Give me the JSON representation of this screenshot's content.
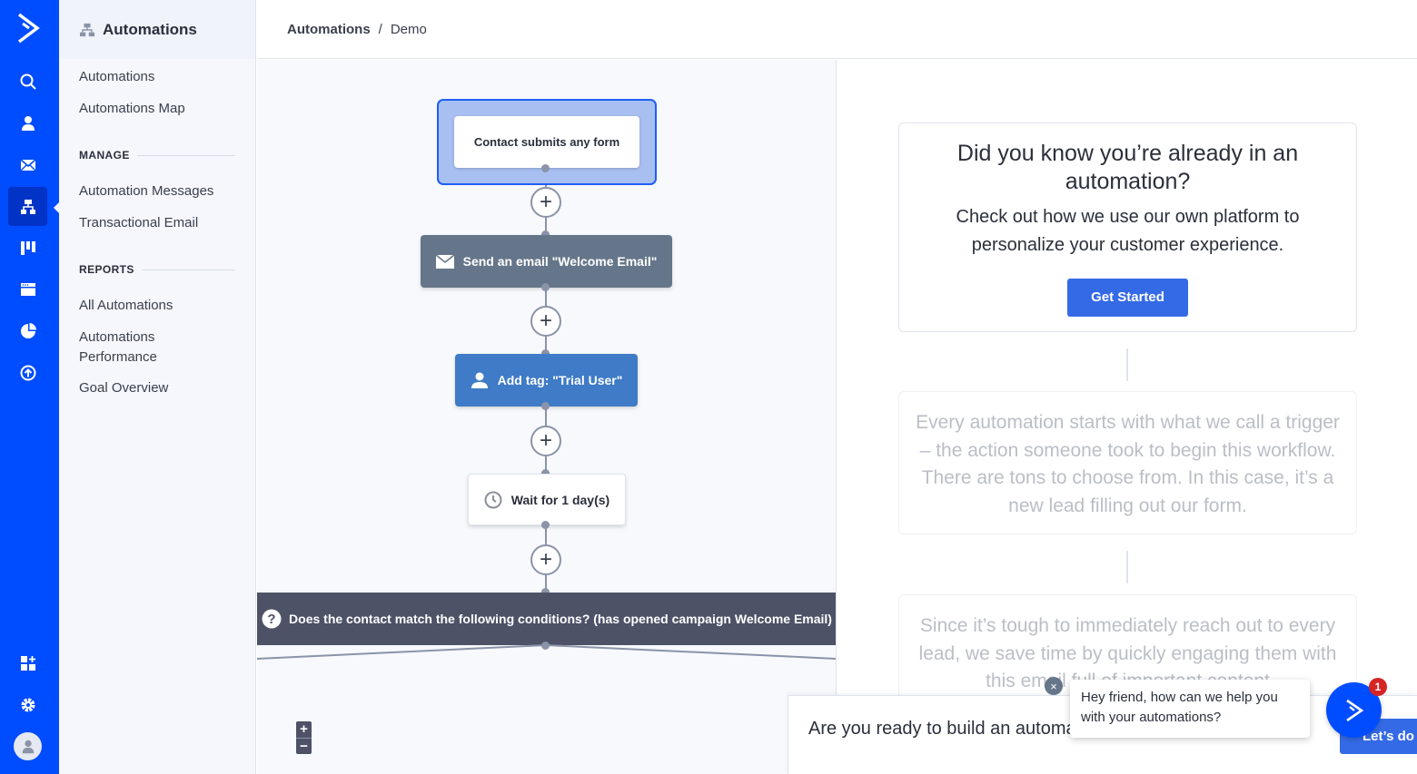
{
  "colors": {
    "brand": "#004cff",
    "brand_active": "#0033c6",
    "primary_button": "#356ae6",
    "email_node": "#66768a",
    "tag_node": "#3f7bc6",
    "condition_node": "#4d5267",
    "trigger_highlight": "#a8bff2",
    "badge": "#d62424"
  },
  "rail": {
    "logo": "activecampaign-logo",
    "items": [
      {
        "icon": "search-icon",
        "label": "Search"
      },
      {
        "icon": "contacts-icon",
        "label": "Contacts"
      },
      {
        "icon": "campaigns-icon",
        "label": "Campaigns"
      },
      {
        "icon": "automations-icon",
        "label": "Automations",
        "active": true
      },
      {
        "icon": "deals-icon",
        "label": "Deals"
      },
      {
        "icon": "website-icon",
        "label": "Website"
      },
      {
        "icon": "reports-icon",
        "label": "Reports"
      },
      {
        "icon": "upgrade-icon",
        "label": "Upgrade"
      }
    ],
    "bottom": [
      {
        "icon": "apps-icon",
        "label": "Apps"
      },
      {
        "icon": "settings-icon",
        "label": "Settings"
      },
      {
        "icon": "avatar-icon",
        "label": "Account"
      }
    ]
  },
  "subnav": {
    "title": "Automations",
    "links": [
      "Automations",
      "Automations Map"
    ],
    "sections": [
      {
        "title": "MANAGE",
        "links": [
          "Automation Messages",
          "Transactional Email"
        ]
      },
      {
        "title": "REPORTS",
        "links": [
          "All Automations",
          "Automations Performance",
          "Goal Overview"
        ]
      }
    ]
  },
  "breadcrumb": {
    "root": "Automations",
    "separator": "/",
    "current": "Demo"
  },
  "workflow": {
    "trigger": "Contact submits any form",
    "steps": [
      {
        "type": "email",
        "icon": "envelope-icon",
        "label": "Send an email \"Welcome Email\""
      },
      {
        "type": "tag",
        "icon": "user-icon",
        "label": "Add tag: \"Trial User\""
      },
      {
        "type": "wait",
        "icon": "clock-icon",
        "label": "Wait for 1 day(s)"
      },
      {
        "type": "condition",
        "icon": "question-icon",
        "label": "Does the contact match the following conditions? (has opened campaign Welcome Email)"
      }
    ],
    "add_step_symbol": "+",
    "zoom_in": "+",
    "zoom_out": "−"
  },
  "guide": {
    "heading": "Did you know you’re already in an automation?",
    "subheading": "Check out how we use our own platform to personalize your customer experience.",
    "cta": "Get Started",
    "steps": [
      "Every automation starts with what we call a trigger – the action someone took to begin this workflow. There are tons to choose from. In this case, it’s a new lead filling out our form.",
      "Since it’s tough to immediately reach out to every lead, we save time by quickly engaging them with this email full of important content"
    ]
  },
  "banner": {
    "text": "Are you ready to build an automation?",
    "cta": "Let’s do it"
  },
  "chat": {
    "message": "Hey friend, how can we help you with your automations?",
    "close": "×",
    "badge_count": "1"
  }
}
